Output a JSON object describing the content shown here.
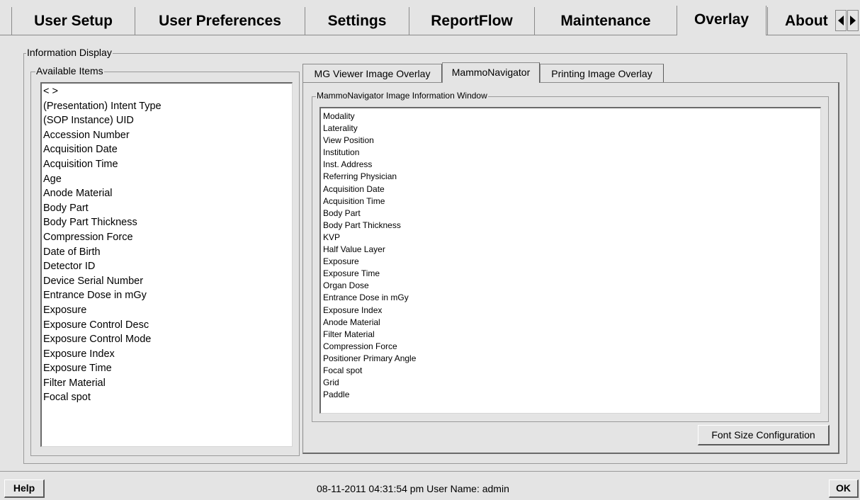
{
  "top_tabs": [
    {
      "label": "User Setup",
      "active": false
    },
    {
      "label": "User Preferences",
      "active": false
    },
    {
      "label": "Settings",
      "active": false
    },
    {
      "label": "ReportFlow",
      "active": false
    },
    {
      "label": "Maintenance",
      "active": false
    },
    {
      "label": "Overlay",
      "active": true
    },
    {
      "label": "About",
      "active": false
    }
  ],
  "information_display": {
    "legend": "Information Display",
    "available_items": {
      "legend": "Available Items",
      "items": [
        "< >",
        "(Presentation) Intent Type",
        "(SOP Instance) UID",
        "Accession Number",
        "Acquisition Date",
        "Acquisition Time",
        "Age",
        "Anode Material",
        "Body Part",
        "Body Part Thickness",
        "Compression Force",
        "Date of Birth",
        "Detector ID",
        "Device Serial Number",
        "Entrance Dose in mGy",
        "Exposure",
        "Exposure Control Desc",
        "Exposure Control Mode",
        "Exposure Index",
        "Exposure Time",
        "Filter Material",
        "Focal spot"
      ]
    },
    "inner_tabs": [
      {
        "label": "MG Viewer Image Overlay",
        "active": false
      },
      {
        "label": "MammoNavigator",
        "active": true
      },
      {
        "label": "Printing Image Overlay",
        "active": false
      }
    ],
    "mammonavigator": {
      "legend": "MammoNavigator Image Information Window",
      "items": [
        "Modality",
        "Laterality",
        "View Position",
        "Institution",
        "Inst. Address",
        "Referring Physician",
        "Acquisition Date",
        "Acquisition Time",
        "Body Part",
        "Body Part Thickness",
        "KVP",
        "Half Value Layer",
        "Exposure",
        "Exposure Time",
        "Organ Dose",
        "Entrance Dose in mGy",
        "Exposure Index",
        "Anode Material",
        "Filter Material",
        "Compression Force",
        "Positioner Primary Angle",
        "Focal spot",
        "Grid",
        "Paddle"
      ],
      "font_size_button": "Font Size Configuration"
    }
  },
  "footer": {
    "help_label": "Help",
    "status_text": "08-11-2011  04:31:54 pm  User Name:  admin",
    "ok_label": "OK"
  }
}
